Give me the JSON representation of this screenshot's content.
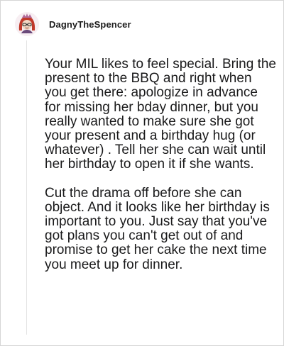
{
  "comment": {
    "author": {
      "username": "DagnyTheSpencer",
      "avatar_icon": "avatar-icon"
    },
    "paragraphs": [
      "Your MIL likes to feel special. Bring the present to the BBQ and right when you get there: apologize in advance for missing her bday dinner, but you really wanted to make sure she got your present and a birthday hug (or whatever) . Tell her she can wait until her birthday to open it if she wants.",
      "Cut the drama off before she can object. And it looks like her birthday is important to you. Just say that you've got plans you can't get out of and promise to get her cake the next time you meet up for dinner."
    ]
  },
  "colors": {
    "text": "#1a1a1b",
    "border": "#d6d6d6",
    "thread_line": "#e3e3e3",
    "avatar_hair": "#c0392b",
    "avatar_skin": "#f2d7c4"
  }
}
